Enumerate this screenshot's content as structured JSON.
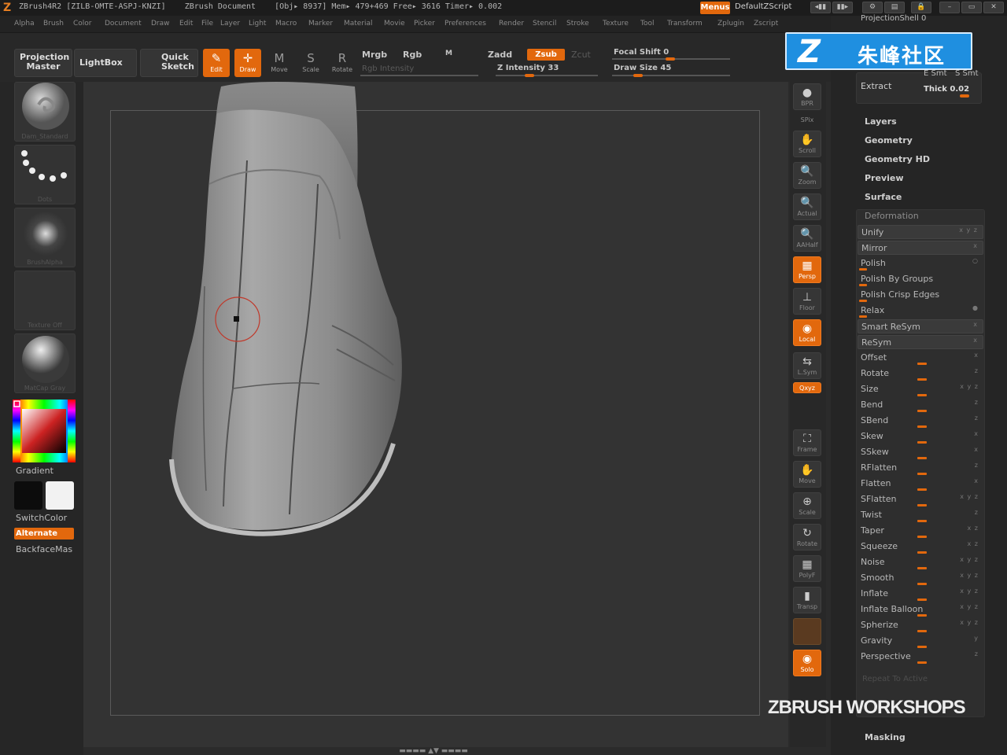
{
  "titlebar": {
    "app": "ZBrush4R2",
    "serial": "[ZILB-OMTE-ASPJ-KNZI]",
    "document": "ZBrush Document",
    "stats": "[Obj▸ 8937] Mem▸ 479+469  Free▸ 3616  Timer▸ 0.002",
    "menus_button": "Menus",
    "script": "DefaultZScript"
  },
  "menubar": [
    "Alpha",
    "Brush",
    "Color",
    "Document",
    "Draw",
    "Edit",
    "File",
    "Layer",
    "Light",
    "Macro",
    "Marker",
    "Material",
    "Movie",
    "Picker",
    "Preferences",
    "Render",
    "Stencil",
    "Stroke",
    "Texture",
    "Tool",
    "Transform",
    "Zplugin",
    "Zscript"
  ],
  "shelf": {
    "projection_master": "Projection Master",
    "lightbox": "LightBox",
    "quick_sketch": "Quick Sketch",
    "tools": [
      {
        "label": "Edit",
        "glyph": "✎",
        "active": true
      },
      {
        "label": "Draw",
        "glyph": "✛",
        "active": true
      },
      {
        "label": "Move",
        "glyph": "M",
        "active": false
      },
      {
        "label": "Scale",
        "glyph": "S",
        "active": false
      },
      {
        "label": "Rotate",
        "glyph": "R",
        "active": false
      }
    ],
    "mrgb": "Mrgb",
    "rgb": "Rgb",
    "m": "M",
    "rgb_intensity": "Rgb Intensity",
    "zadd": "Zadd",
    "zsub": "Zsub",
    "zcut": "Zcut",
    "z_intensity": "Z Intensity 33",
    "focal_shift": "Focal Shift 0",
    "draw_size": "Draw Size 45",
    "z_intensity_value": 33,
    "draw_size_value": 45
  },
  "left": {
    "brush": "Dam_Standard",
    "stroke": "Dots",
    "alpha": "BrushAlpha",
    "texture": "Texture Off",
    "material": "MatCap Gray",
    "gradient": "Gradient",
    "switchcolor": "SwitchColor",
    "alternate": "Alternate",
    "backface": "BackfaceMas"
  },
  "rightcol": [
    {
      "label": "BPR",
      "glyph": "●"
    },
    {
      "label": "SPix",
      "glyph": ""
    },
    {
      "label": "Scroll",
      "glyph": "✋"
    },
    {
      "label": "Zoom",
      "glyph": "🔍"
    },
    {
      "label": "Actual",
      "glyph": "🔍"
    },
    {
      "label": "AAHalf",
      "glyph": "🔍"
    },
    {
      "label": "Persp",
      "glyph": "▦",
      "active": true
    },
    {
      "label": "Floor",
      "glyph": "⊥"
    },
    {
      "label": "Local",
      "glyph": "◉",
      "active": true
    },
    {
      "label": "L.Sym",
      "glyph": "⇆"
    },
    {
      "label": "Qxyz",
      "glyph": "",
      "active": true
    },
    {
      "label": "Frame",
      "glyph": "⛶"
    },
    {
      "label": "Move",
      "glyph": "✋"
    },
    {
      "label": "Scale",
      "glyph": "⊕"
    },
    {
      "label": "Rotate",
      "glyph": "↻"
    },
    {
      "label": "PolyF",
      "glyph": "▦"
    },
    {
      "label": "Transp",
      "glyph": "▮"
    },
    {
      "label": "Solo",
      "glyph": "◉",
      "active": true
    }
  ],
  "rightpanel": {
    "projection_shell": "ProjectionShell 0",
    "extract": "Extract",
    "e_smt": "E Smt",
    "s_smt": "S Smt",
    "thick": "Thick 0.02",
    "sections": [
      "Layers",
      "Geometry",
      "Geometry HD",
      "Preview",
      "Surface"
    ],
    "deformation_title": "Deformation",
    "deformation": [
      {
        "label": "Unify",
        "type": "btn",
        "xyz": "x y z"
      },
      {
        "label": "Mirror",
        "type": "btn",
        "xyz": "x"
      },
      {
        "label": "Polish",
        "type": "slider",
        "xyz": "○"
      },
      {
        "label": "Polish By Groups",
        "type": "slider",
        "xyz": ""
      },
      {
        "label": "Polish Crisp Edges",
        "type": "slider",
        "xyz": ""
      },
      {
        "label": "Relax",
        "type": "slider",
        "xyz": "●"
      },
      {
        "label": "Smart ReSym",
        "type": "btn",
        "xyz": "x"
      },
      {
        "label": "ReSym",
        "type": "btn",
        "xyz": "x"
      },
      {
        "label": "Offset",
        "type": "slider",
        "xyz": "x"
      },
      {
        "label": "Rotate",
        "type": "slider",
        "xyz": "z"
      },
      {
        "label": "Size",
        "type": "slider",
        "xyz": "x y z"
      },
      {
        "label": "Bend",
        "type": "slider",
        "xyz": "z"
      },
      {
        "label": "SBend",
        "type": "slider",
        "xyz": "z"
      },
      {
        "label": "Skew",
        "type": "slider",
        "xyz": "x"
      },
      {
        "label": "SSkew",
        "type": "slider",
        "xyz": "x"
      },
      {
        "label": "RFlatten",
        "type": "slider",
        "xyz": "z"
      },
      {
        "label": "Flatten",
        "type": "slider",
        "xyz": "x"
      },
      {
        "label": "SFlatten",
        "type": "slider",
        "xyz": "x y z"
      },
      {
        "label": "Twist",
        "type": "slider",
        "xyz": "z"
      },
      {
        "label": "Taper",
        "type": "slider",
        "xyz": "x z"
      },
      {
        "label": "Squeeze",
        "type": "slider",
        "xyz": "x z"
      },
      {
        "label": "Noise",
        "type": "slider",
        "xyz": "x y z"
      },
      {
        "label": "Smooth",
        "type": "slider",
        "xyz": "x y z"
      },
      {
        "label": "Inflate",
        "type": "slider",
        "xyz": "x y z"
      },
      {
        "label": "Inflate Balloon",
        "type": "slider",
        "xyz": "x y z"
      },
      {
        "label": "Spherize",
        "type": "slider",
        "xyz": "x y z"
      },
      {
        "label": "Gravity",
        "type": "slider",
        "xyz": "y"
      },
      {
        "label": "Perspective",
        "type": "slider",
        "xyz": "z"
      }
    ],
    "repeat_to_active": "Repeat To Active",
    "masking": "Masking"
  },
  "watermark": {
    "cn": "朱峰社区",
    "logo": "Z",
    "workshops": "ZBRUSH WORKSHOPS"
  },
  "colors": {
    "accent": "#e2680d",
    "bg": "#2b2b2b",
    "canvas": "#333333",
    "model": "#9a9a9a"
  }
}
